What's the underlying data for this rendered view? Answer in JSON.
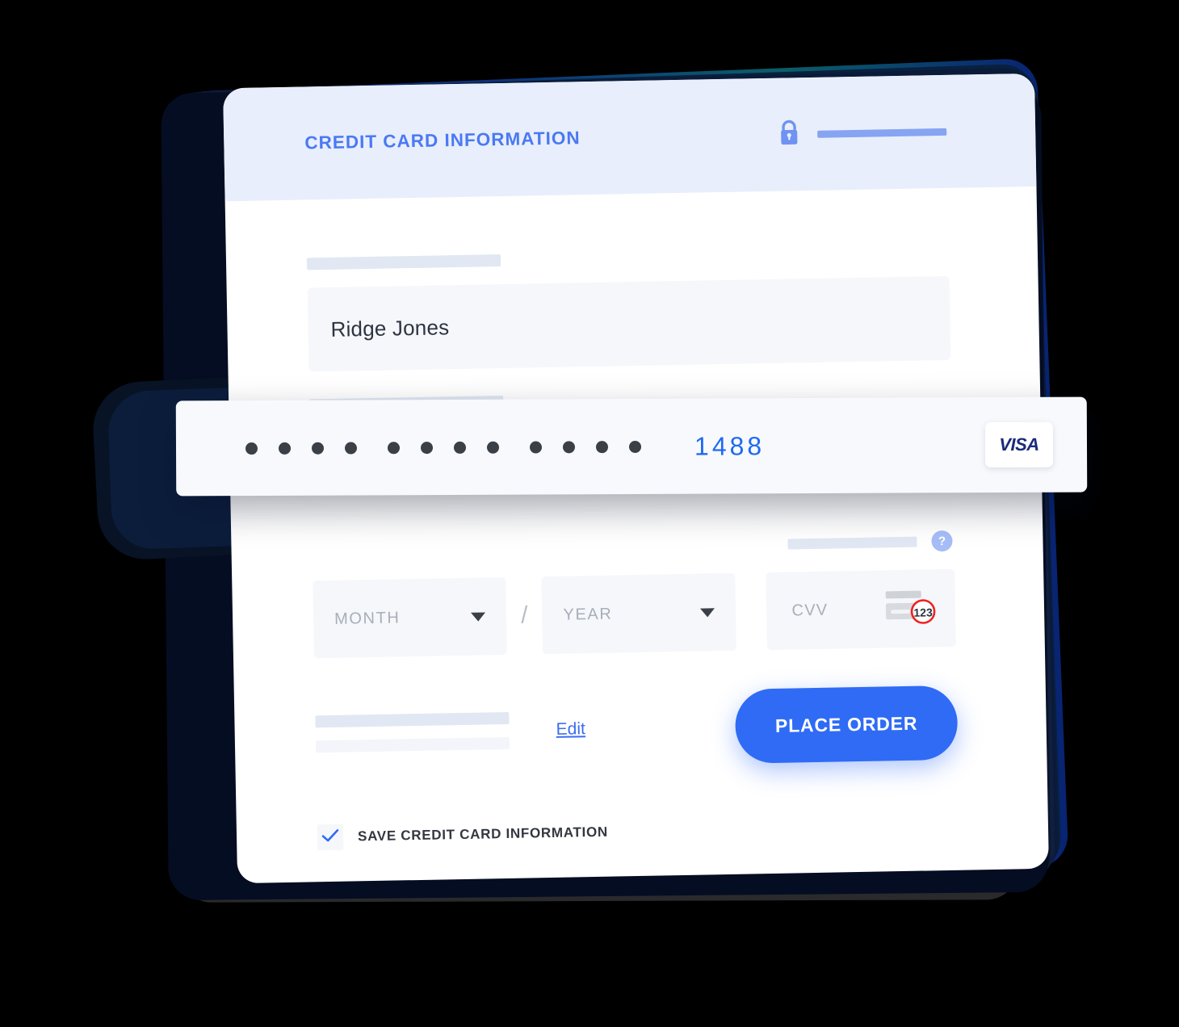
{
  "background_color": "#000000",
  "accent_color": "#2f6bf5",
  "panel": {
    "header": {
      "title": "CREDIT CARD INFORMATION",
      "lock_icon": "lock-icon",
      "secure_bar_color": "#86a4f2"
    },
    "cardholder": {
      "label_placeholder": "",
      "value": "Ridge Jones"
    },
    "card_number": {
      "masked_digit_count": 12,
      "group_count": 3,
      "last_four": "1488",
      "brand": "VISA",
      "brand_icon": "visa-logo-icon"
    },
    "expiry": {
      "month_placeholder": "MONTH",
      "separator": "/",
      "year_placeholder": "YEAR",
      "caret_icon": "chevron-down-icon"
    },
    "cvv": {
      "placeholder": "CVV",
      "help_icon": "question-mark-icon",
      "help_label": "?",
      "card_back_icon": "card-back-cvv-icon",
      "card_back_digits": "123"
    },
    "actions": {
      "edit_label": "Edit",
      "place_order_label": "PLACE ORDER"
    },
    "save": {
      "checked": true,
      "check_icon": "checkmark-icon",
      "label": "SAVE CREDIT CARD INFORMATION"
    }
  }
}
